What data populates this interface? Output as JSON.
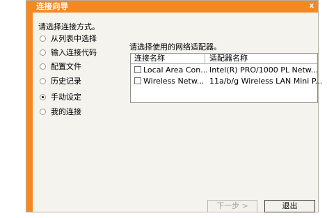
{
  "window": {
    "title": "连接向导",
    "close_label": "x"
  },
  "left_panel": {
    "prompt": "请选择连接方式。",
    "options": [
      {
        "label": "从列表中选择",
        "selected": false
      },
      {
        "label": "输入连接代码",
        "selected": false
      },
      {
        "label": "配置文件",
        "selected": false
      },
      {
        "label": "历史记录",
        "selected": false
      },
      {
        "label": "手动设定",
        "selected": true
      },
      {
        "label": "我的连接",
        "selected": false
      }
    ]
  },
  "adapters": {
    "prompt": "请选择使用的网络适配器。",
    "columns": [
      "连接名称",
      "适配器名称"
    ],
    "rows": [
      {
        "checked": false,
        "name": "Local Area Con...",
        "adapter": "Intel(R) PRO/1000 PL Netw..."
      },
      {
        "checked": false,
        "name": "Wireless Netw...",
        "adapter": "11a/b/g Wireless LAN Mini P..."
      }
    ]
  },
  "buttons": {
    "next": "下一步 >",
    "exit": "退出"
  },
  "colors": {
    "accent": "#f58820",
    "panel": "#f4f3ee"
  }
}
